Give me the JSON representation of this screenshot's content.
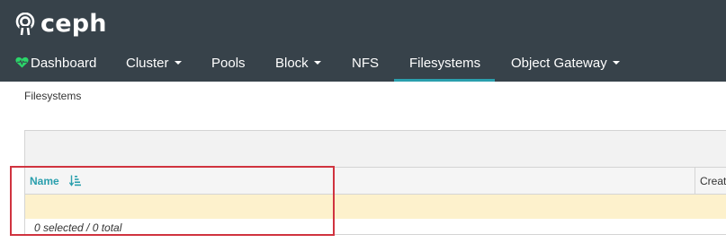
{
  "app": {
    "logo_text": "ceph"
  },
  "nav": {
    "dashboard": "Dashboard",
    "cluster": "Cluster",
    "pools": "Pools",
    "block": "Block",
    "nfs": "NFS",
    "filesystems": "Filesystems",
    "object_gateway": "Object Gateway",
    "active": "Filesystems"
  },
  "breadcrumb": "Filesystems",
  "table": {
    "columns": [
      "Name",
      "Creat"
    ],
    "rows": [],
    "footer": "0 selected / 0 total"
  },
  "colors": {
    "topbar": "#37424a",
    "accent": "#2a9fad",
    "heart": "#2bd66a",
    "empty_row": "#fdf1cc",
    "highlight": "#d0333f"
  },
  "icons": [
    "ceph-logo-icon",
    "heart-icon",
    "caret-down-icon",
    "sort-amount-down-icon"
  ]
}
